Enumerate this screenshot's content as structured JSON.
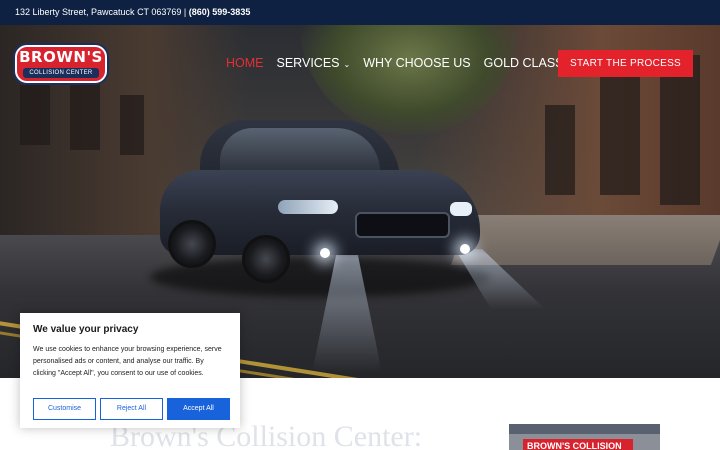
{
  "topbar": {
    "address": "132 Liberty Street, Pawcatuck CT 063769 | ",
    "phone": "(860) 599-3835"
  },
  "logo": {
    "name": "BROWN'S",
    "sub": "COLLISION CENTER"
  },
  "nav": {
    "items": [
      {
        "label": "HOME",
        "active": true
      },
      {
        "label": "SERVICES",
        "dropdown": true
      },
      {
        "label": "WHY CHOOSE US"
      },
      {
        "label": "GOLD CLASS",
        "dropdown": true
      }
    ],
    "cta": "START THE PROCESS"
  },
  "hero": {
    "image": "dark-subaru-sedan-on-city-street"
  },
  "main": {
    "heading": "Brown's Collision Center:",
    "photo_sign": "BROWN'S COLLISION"
  },
  "cookie": {
    "title": "We value your privacy",
    "text": "We use cookies to enhance your browsing experience, serve personalised ads or content, and analyse our traffic. By clicking \"Accept All\", you consent to our use of cookies.",
    "customise": "Customise",
    "reject": "Reject All",
    "accept": "Accept All"
  },
  "colors": {
    "topbar": "#0e2142",
    "accent": "#e4222b",
    "cookie_button": "#1863dc"
  }
}
